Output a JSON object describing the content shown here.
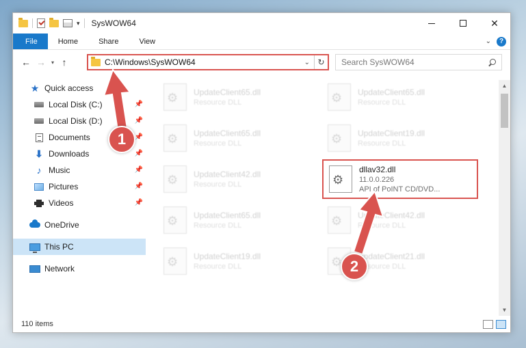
{
  "window": {
    "title": "SysWOW64",
    "controls": {
      "minimize_icon": "minimize-icon",
      "maximize_icon": "maximize-icon",
      "close_label": "✕"
    }
  },
  "ribbon": {
    "tabs": [
      "File",
      "Home",
      "Share",
      "View"
    ],
    "help_label": "?"
  },
  "navigation": {
    "address": "C:\\Windows\\SysWOW64",
    "search_placeholder": "Search SysWOW64"
  },
  "sidebar": {
    "items": [
      {
        "label": "Quick access",
        "icon": "star-icon"
      },
      {
        "label": "Local Disk (C:)",
        "icon": "disk-icon",
        "pinned": true
      },
      {
        "label": "Local Disk (D:)",
        "icon": "disk-icon",
        "pinned": true
      },
      {
        "label": "Documents",
        "icon": "documents-icon",
        "pinned": true
      },
      {
        "label": "Downloads",
        "icon": "download-icon",
        "pinned": true
      },
      {
        "label": "Music",
        "icon": "music-icon",
        "pinned": true
      },
      {
        "label": "Pictures",
        "icon": "pictures-icon",
        "pinned": true
      },
      {
        "label": "Videos",
        "icon": "videos-icon",
        "pinned": true
      },
      {
        "label": "OneDrive",
        "icon": "cloud-icon"
      },
      {
        "label": "This PC",
        "icon": "pc-icon",
        "selected": true
      },
      {
        "label": "Network",
        "icon": "network-icon"
      }
    ]
  },
  "files": [
    {
      "name": "UpdateClient65.dll",
      "type": "Resource DLL"
    },
    {
      "name": "UpdateClient65.dll",
      "type": "Resource DLL"
    },
    {
      "name": "UpdateClient65.dll",
      "type": "Resource DLL"
    },
    {
      "name": "UpdateClient19.dll",
      "type": "Resource DLL"
    },
    {
      "name": "UpdateClient42.dll",
      "type": "Resource DLL"
    },
    {
      "name": "dllav32.dll",
      "version": "11.0.0.226",
      "type": "API of PoINT CD/DVD..."
    },
    {
      "name": "UpdateClient65.dll",
      "type": "Resource DLL"
    },
    {
      "name": "UpdateClient42.dll",
      "type": "Resource DLL"
    },
    {
      "name": "UpdateClient19.dll",
      "type": "Resource DLL"
    },
    {
      "name": "UpdateClient21.dll",
      "type": "Resource DLL"
    }
  ],
  "status": {
    "item_count": "110 items"
  },
  "annotations": {
    "step1": "1",
    "step2": "2",
    "color": "#d9534f"
  }
}
